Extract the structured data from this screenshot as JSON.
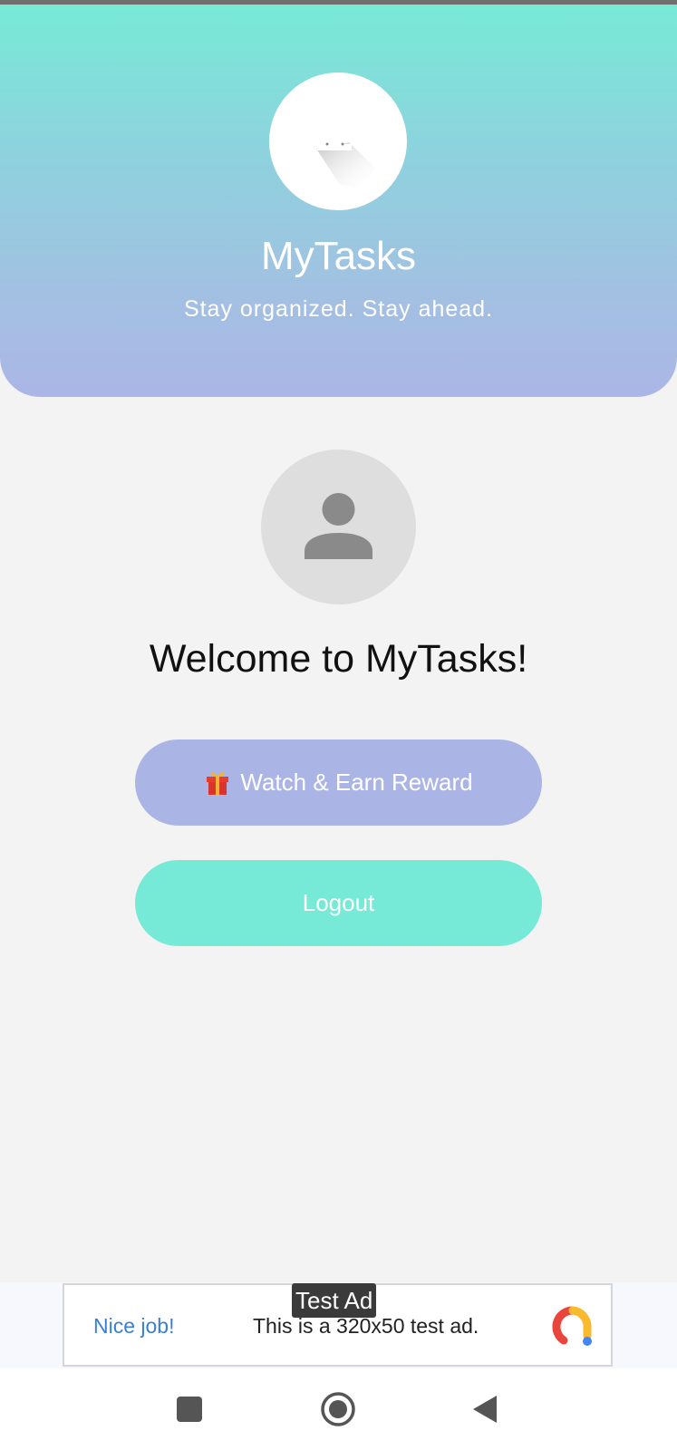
{
  "header": {
    "app_title": "MyTasks",
    "subtitle": "Stay organized. Stay ahead.",
    "logo_icon": "calendar-logo-icon",
    "gradient_top": "#77ead6",
    "gradient_bottom": "#abb6e6"
  },
  "profile": {
    "avatar_icon": "person-icon",
    "welcome_text": "Welcome to MyTasks!"
  },
  "buttons": {
    "reward_icon": "gift-icon",
    "reward_label": "Watch & Earn Reward",
    "reward_color": "#abb5e5",
    "logout_label": "Logout",
    "logout_color": "#76ead6"
  },
  "ad": {
    "badge": "Test Ad",
    "cta": "Nice job!",
    "text": "This is a 320x50 test ad.",
    "logo_icon": "ad-logo-icon"
  },
  "nav": {
    "items": [
      {
        "icon": "recents-square-icon"
      },
      {
        "icon": "home-circle-icon"
      },
      {
        "icon": "back-triangle-icon"
      }
    ]
  }
}
